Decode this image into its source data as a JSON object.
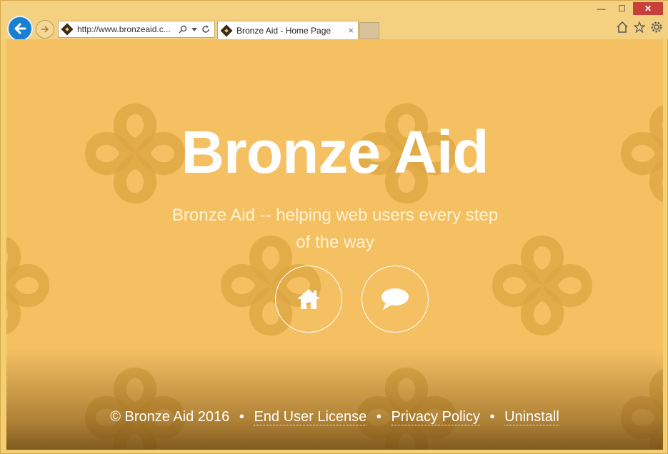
{
  "browser": {
    "address_url": "http://www.bronzeaid.c...",
    "tab_title": "Bronze Aid - Home Page",
    "tab_close": "×",
    "window_minimize": "—",
    "window_maximize": "☐",
    "window_close": "✕"
  },
  "page": {
    "title": "Bronze Aid",
    "subtitle": "Bronze Aid -- helping web users every step of the way",
    "footer": {
      "copyright": "© Bronze Aid 2016",
      "separator": "•",
      "links": [
        "End User License",
        "Privacy Policy",
        "Uninstall"
      ]
    }
  },
  "icons": {
    "home_button": "home-icon",
    "chat_button": "chat-bubble-icon"
  },
  "colors": {
    "page_bg": "#f4c062",
    "pattern": "#d9a13c",
    "text": "#ffffff",
    "back_button": "#1a7fd0"
  }
}
